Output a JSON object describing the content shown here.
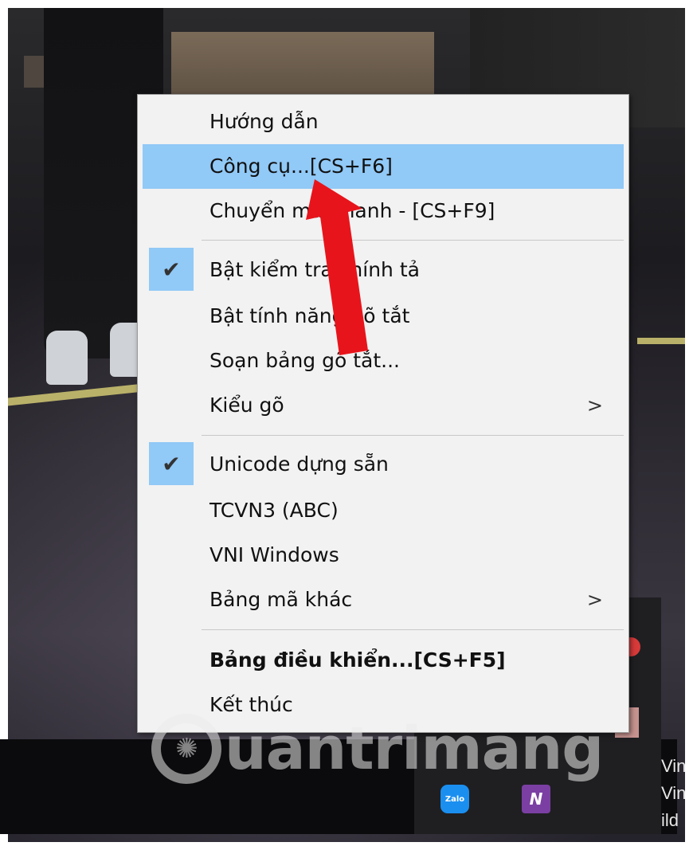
{
  "menu": {
    "items": [
      {
        "label": "Hướng dẫn",
        "checked": false,
        "submenu": false,
        "bold": false,
        "highlighted": false
      },
      {
        "label": "Công cụ...[CS+F6]",
        "checked": false,
        "submenu": false,
        "bold": false,
        "highlighted": true
      },
      {
        "label": "Chuyển mã nhanh - [CS+F9]",
        "checked": false,
        "submenu": false,
        "bold": false,
        "highlighted": false
      },
      {
        "label": "Bật kiểm tra chính tả",
        "checked": true,
        "submenu": false,
        "bold": false,
        "highlighted": false
      },
      {
        "label": "Bật tính năng gõ tắt",
        "checked": false,
        "submenu": false,
        "bold": false,
        "highlighted": false
      },
      {
        "label": "Soạn bảng gõ tắt...",
        "checked": false,
        "submenu": false,
        "bold": false,
        "highlighted": false
      },
      {
        "label": "Kiểu gõ",
        "checked": false,
        "submenu": true,
        "bold": false,
        "highlighted": false
      },
      {
        "label": "Unicode dựng sẵn",
        "checked": true,
        "submenu": false,
        "bold": false,
        "highlighted": false
      },
      {
        "label": "TCVN3 (ABC)",
        "checked": false,
        "submenu": false,
        "bold": false,
        "highlighted": false
      },
      {
        "label": "VNI Windows",
        "checked": false,
        "submenu": false,
        "bold": false,
        "highlighted": false
      },
      {
        "label": "Bảng mã khác",
        "checked": false,
        "submenu": true,
        "bold": false,
        "highlighted": false
      },
      {
        "label": "Bảng điều khiển...[CS+F5]",
        "checked": false,
        "submenu": false,
        "bold": true,
        "highlighted": false
      },
      {
        "label": "Kết thúc",
        "checked": false,
        "submenu": false,
        "bold": false,
        "highlighted": false
      }
    ],
    "check_glyph": "✔",
    "submenu_glyph": ">"
  },
  "tray": {
    "zalo_label": "Zalo",
    "onenote_label": "N",
    "side_text": [
      "Vin",
      "Vin",
      "ild"
    ]
  },
  "watermark": {
    "text": "uantrimang"
  },
  "colors": {
    "highlight": "#91c9f7",
    "menu_bg": "#f2f2f2",
    "annotation_arrow": "#e8141b"
  }
}
